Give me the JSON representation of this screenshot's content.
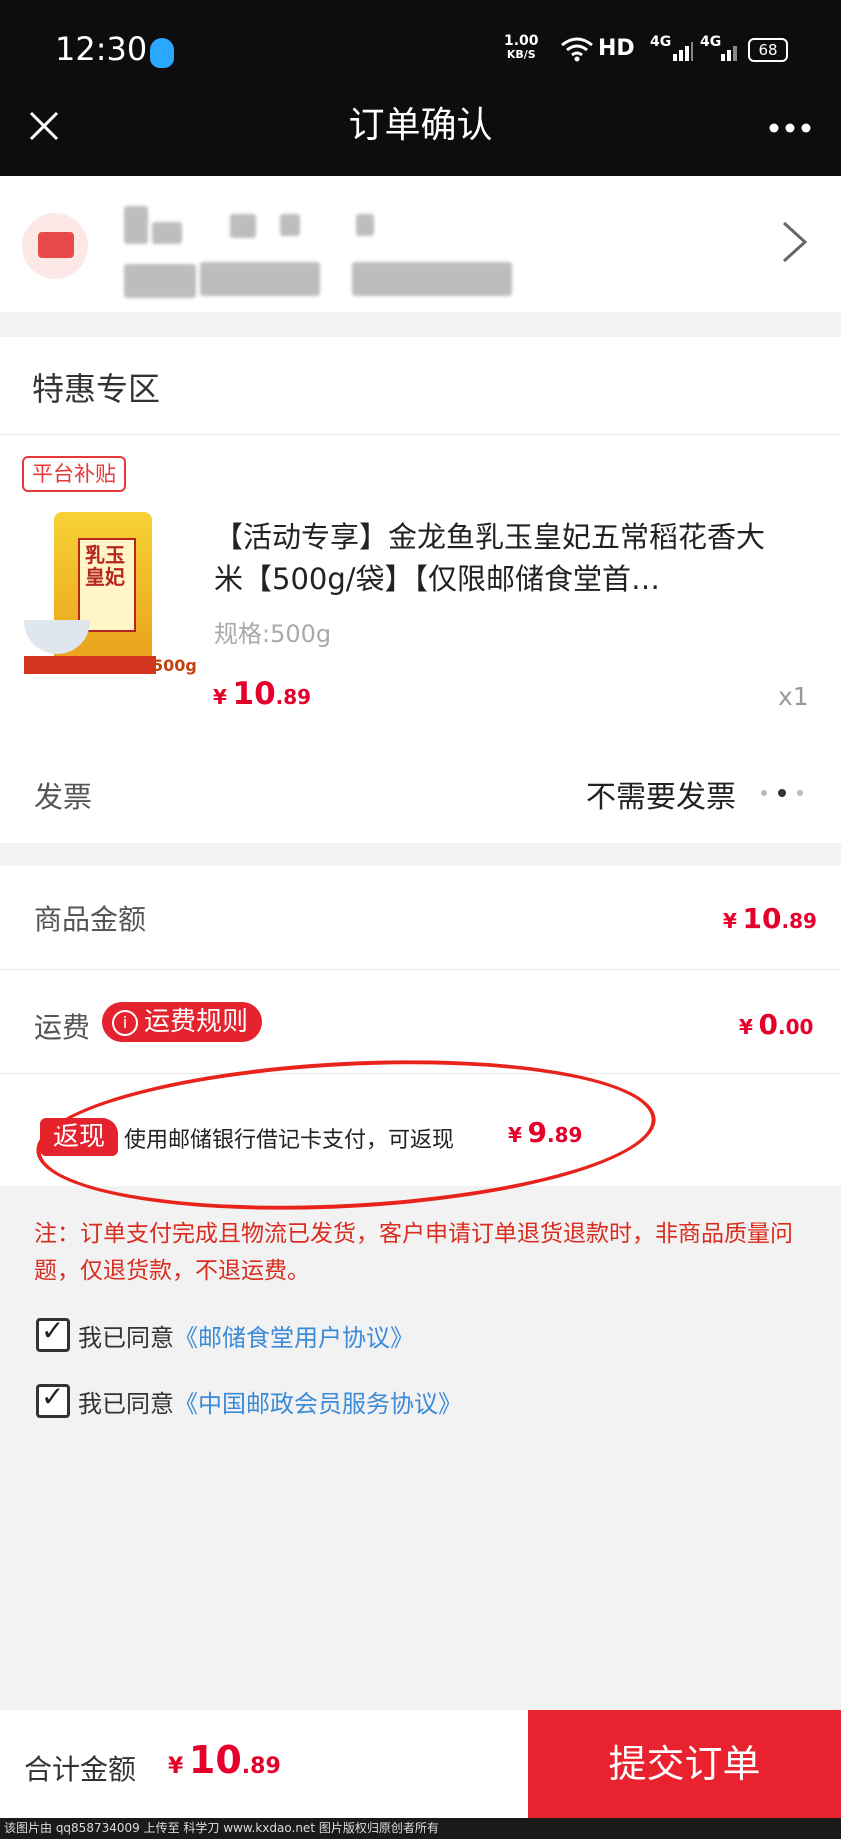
{
  "status_bar": {
    "time": "12:30",
    "speed_value": "1.00",
    "speed_unit": "KB/S",
    "hd": "HD",
    "net1": "4G",
    "net2": "4G",
    "battery": "68"
  },
  "nav": {
    "close_icon": "close-icon",
    "title": "订单确认",
    "more_icon": "more-icon"
  },
  "special_zone": {
    "title": "特惠专区",
    "tag": "平台补贴",
    "product": {
      "title": "【活动专享】金龙鱼乳玉皇妃五常稻花香大米【500g/袋】【仅限邮储食堂首…",
      "spec": "规格:500g",
      "price_symbol": "¥",
      "price_int": "10",
      "price_dec": ".89",
      "qty": "x1",
      "image_text": "乳玉皇妃",
      "image_weight": "500g"
    },
    "invoice": {
      "label": "发票",
      "value": "不需要发票"
    }
  },
  "amounts": {
    "goods_label": "商品金额",
    "goods_symbol": "¥",
    "goods_int": "10",
    "goods_dec": ".89",
    "ship_label": "运费",
    "ship_rule_label": "运费规则",
    "ship_symbol": "¥",
    "ship_int": "0",
    "ship_dec": ".00",
    "cashback_tag": "返现",
    "cashback_text": "使用邮储银行借记卡支付，可返现",
    "cashback_symbol": "¥",
    "cashback_int": "9",
    "cashback_dec": ".89"
  },
  "note": "注：订单支付完成且物流已发货，客户申请订单退货退款时，非商品质量问题，仅退货款，不退运费。",
  "agreements": [
    {
      "prefix": "我已同意",
      "link": "《邮储食堂用户协议》",
      "checked": true
    },
    {
      "prefix": "我已同意",
      "link": "《中国邮政会员服务协议》",
      "checked": true
    }
  ],
  "bottom_bar": {
    "total_label": "合计金额",
    "total_symbol": "¥",
    "total_int": "10",
    "total_dec": ".89",
    "submit_label": "提交订单"
  },
  "watermark": "该图片由 qq858734009 上传至 科学刀 www.kxdao.net 图片版权归原创者所有",
  "colors": {
    "accent_red": "#e4232f",
    "link_blue": "#3b8bd8"
  }
}
